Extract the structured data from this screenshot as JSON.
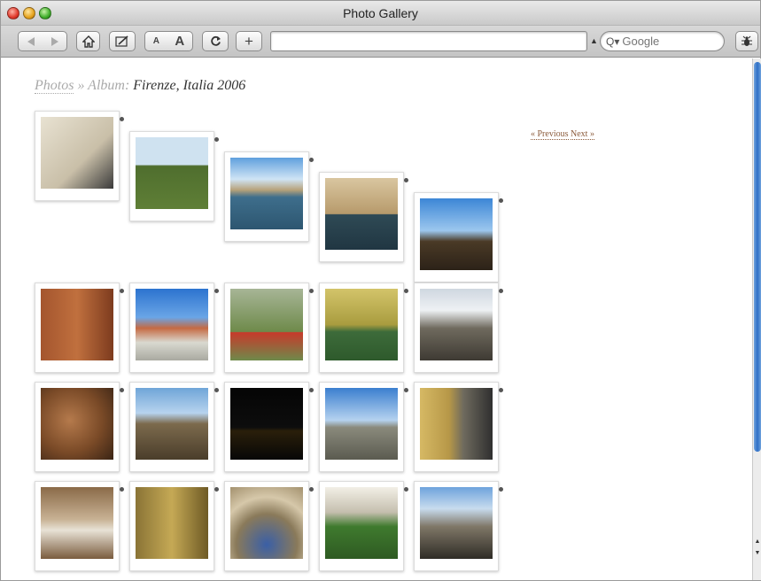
{
  "window": {
    "title": "Photo Gallery"
  },
  "toolbar": {
    "text_small": "A",
    "text_big": "A",
    "add_label": "+",
    "url_value": "",
    "search_placeholder": "Google"
  },
  "breadcrumb": {
    "photos": "Photos",
    "sep1": " » ",
    "album": "Album:",
    "current": "Firenze, Italia 2006"
  },
  "pager": {
    "previous": "« Previous",
    "next": "Next »"
  },
  "photos": [
    {
      "name": "graffiti-girl",
      "bg": "linear-gradient(135deg,#e8e2d2,#c9bfa8 60%,#3a3a3a)"
    },
    {
      "name": "tuscan-olive-grove",
      "bg": "linear-gradient(#cfe2f0 0%,#cfe2f0 38%,#4f6e2e 40%,#5f7f36 100%)"
    },
    {
      "name": "arno-river-bridge",
      "bg": "linear-gradient(#5fa0dd 0%,#cfe4f5 30%,#b7a27a 45%,#3e6e8c 55%,#2d5670 100%)"
    },
    {
      "name": "perseus-bronze-statue",
      "bg": "linear-gradient(#d9c6a0,#b79a6b 50%,#2f4a55 51%,#203642)"
    },
    {
      "name": "palm-and-stone-building",
      "bg": "linear-gradient(#3c86d6 0%,#9cc7ee 45%,#4a3a26 60%,#2c2218 100%)"
    },
    {
      "name": "brick-wall-sign",
      "bg": "linear-gradient(90deg,#a4552e,#c0703e 50%,#7d3b1e)"
    },
    {
      "name": "duomo-dome",
      "bg": "linear-gradient(#2c73cf 0%,#6aa5e6 40%,#c56a43 55%,#d9d9d0 75%,#a9a9a0 100%)"
    },
    {
      "name": "road-sign-graffiti",
      "bg": "linear-gradient(#a7b596 0%,#6e8a4a 60%,#c73a2b 61%,#6e8a4a 100%)"
    },
    {
      "name": "yellow-facade",
      "bg": "linear-gradient(#d3c46a,#a99c3f 50%,#3d6b3a 60%,#2e5a2c)"
    },
    {
      "name": "cathedral-bell-tower",
      "bg": "linear-gradient(#cfd7e0 0%,#eef1f4 30%,#6f6a5e 55%,#3e3a33 100%)"
    },
    {
      "name": "wine-barrels",
      "bg": "radial-gradient(circle at 40% 45%,#b57a4c,#7a4a27 55%,#3a2415)"
    },
    {
      "name": "medieval-tower",
      "bg": "linear-gradient(#6fa5d8 0%,#b7d3ee 35%,#7c6a4d 50%,#4a3d2a 100%)"
    },
    {
      "name": "river-at-night",
      "bg": "linear-gradient(#050505 0%,#0d0d0d 55%,#2a1f0a 60%,#070707 100%)"
    },
    {
      "name": "statue-on-rooftop",
      "bg": "linear-gradient(#3b7fcf 0%,#b5d2ef 45%,#8a8a7c 55%,#5b5b50 100%)"
    },
    {
      "name": "narrow-street-scooters",
      "bg": "linear-gradient(90deg,#d6b964,#b79848 40%,#6e6a5e 60%,#2f2f2f)"
    },
    {
      "name": "david-statue-palazzo",
      "bg": "linear-gradient(#8a6a48,#c8b294 45%,#e8e2d6 60%,#7a5c3e)"
    },
    {
      "name": "gates-of-paradise",
      "bg": "linear-gradient(90deg,#8a7436,#c5a955 50%,#6e5a25)"
    },
    {
      "name": "arch-lunette",
      "bg": "radial-gradient(circle at 50% 80%,#3a5fa6,#8a7a5a 45%,#d6c8aa 70%,#a3916e)"
    },
    {
      "name": "cloister-garden",
      "bg": "linear-gradient(#f2efe6 0%,#c5bfae 35%,#3f7a2e 55%,#2e5a22 100%)"
    },
    {
      "name": "street-pedestrians",
      "bg": "linear-gradient(#6ea3dc 0%,#c8dcee 30%,#7f7767 55%,#2f2c26 100%)"
    }
  ]
}
